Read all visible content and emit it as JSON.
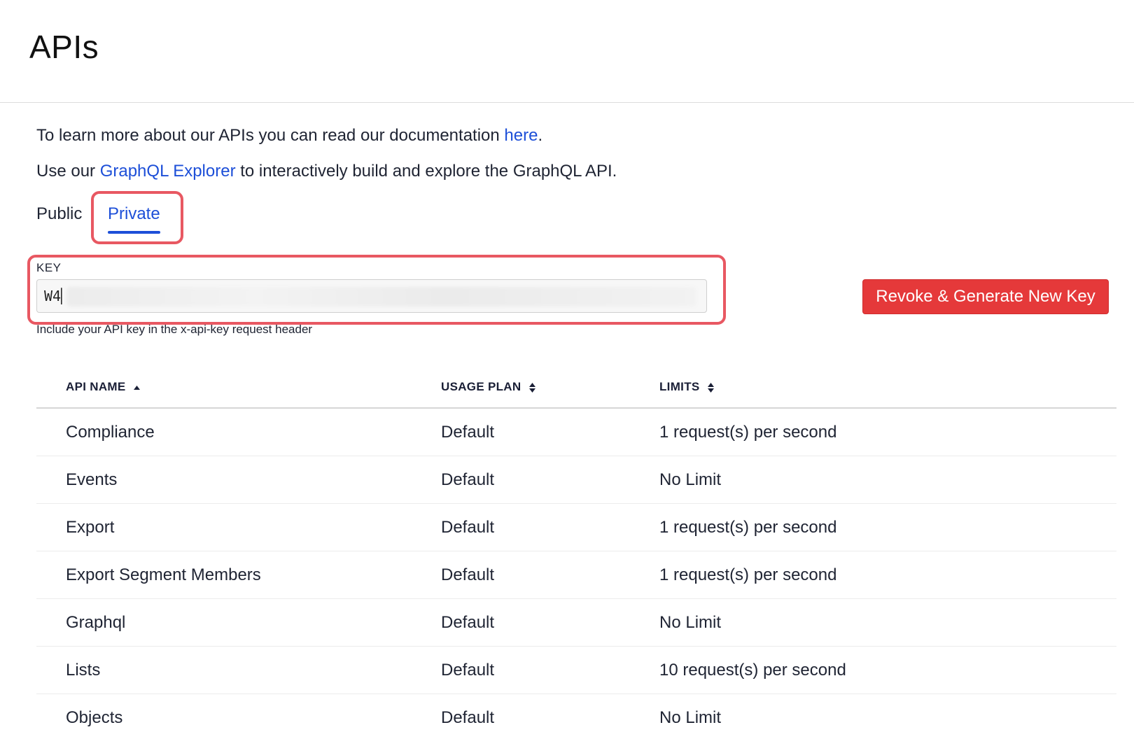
{
  "header": {
    "title": "APIs"
  },
  "intro": {
    "line1_prefix": "To learn more about our APIs you can read our documentation ",
    "line1_link": "here",
    "line1_suffix": ".",
    "line2_prefix": "Use our ",
    "line2_link": "GraphQL Explorer",
    "line2_suffix": " to interactively build and explore the GraphQL API."
  },
  "tabs": [
    {
      "label": "Public",
      "active": false
    },
    {
      "label": "Private",
      "active": true
    }
  ],
  "key": {
    "label": "KEY",
    "value_visible": "W4▏",
    "help": "Include your API key in the x-api-key request header"
  },
  "actions": {
    "revoke_label": "Revoke & Generate New Key"
  },
  "colors": {
    "accent": "#1d4fd8",
    "danger": "#e5393a",
    "highlight": "#e85862"
  },
  "table": {
    "columns": [
      {
        "label": "API NAME",
        "sort": "asc",
        "icon": "sort-up-icon"
      },
      {
        "label": "USAGE PLAN",
        "sort": "none",
        "icon": "sort-icon"
      },
      {
        "label": "LIMITS",
        "sort": "none",
        "icon": "sort-icon"
      }
    ],
    "rows": [
      {
        "name": "Compliance",
        "plan": "Default",
        "limit": "1 request(s) per second"
      },
      {
        "name": "Events",
        "plan": "Default",
        "limit": "No Limit"
      },
      {
        "name": "Export",
        "plan": "Default",
        "limit": "1 request(s) per second"
      },
      {
        "name": "Export Segment Members",
        "plan": "Default",
        "limit": "1 request(s) per second"
      },
      {
        "name": "Graphql",
        "plan": "Default",
        "limit": "No Limit"
      },
      {
        "name": "Lists",
        "plan": "Default",
        "limit": "10 request(s) per second"
      },
      {
        "name": "Objects",
        "plan": "Default",
        "limit": "No Limit"
      }
    ]
  }
}
